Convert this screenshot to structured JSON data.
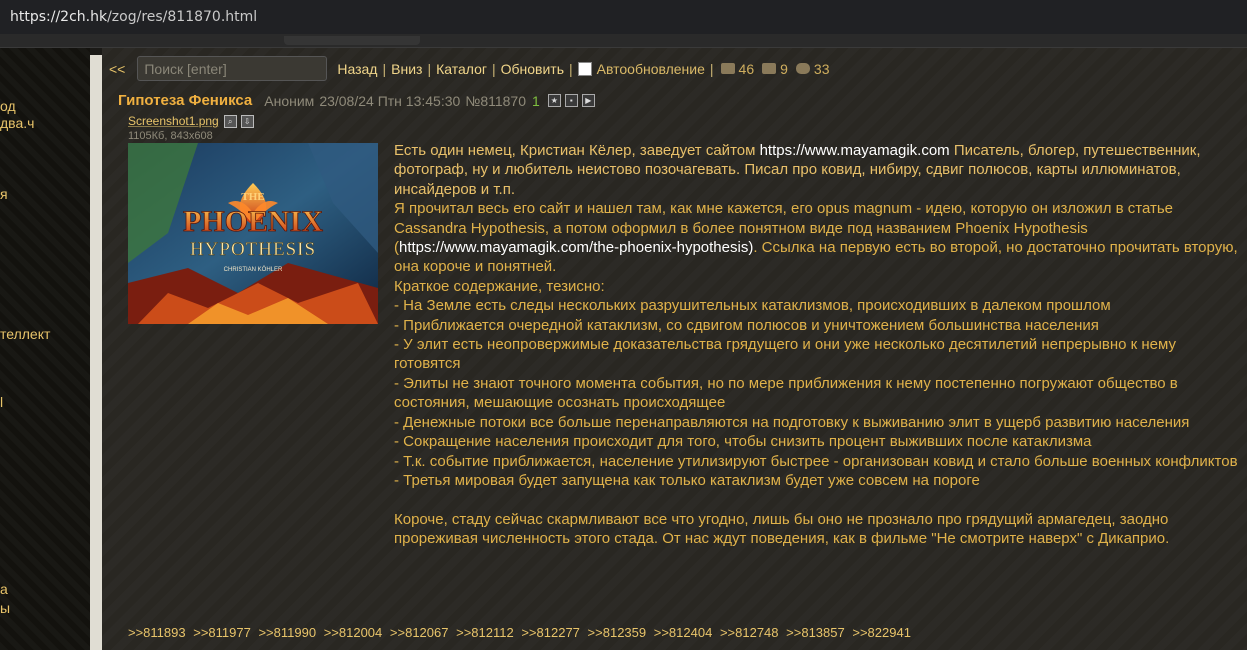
{
  "browser": {
    "url_host": "https://2ch.hk",
    "url_path": "/zog/res/811870.html"
  },
  "sidebar": {
    "items": [
      "од",
      "два.ч",
      "я",
      "теллект",
      "l",
      "а",
      "ы"
    ]
  },
  "toolbar": {
    "back": "<<",
    "search_placeholder": "Поиск [enter]",
    "links": [
      "Назад",
      "Вниз",
      "Каталог",
      "Обновить"
    ],
    "autoupdate_label": "Автообновление",
    "posts_count": "46",
    "images_count": "9",
    "posters_count": "33"
  },
  "post": {
    "title": "Гипотеза Феникса",
    "author": "Аноним",
    "date": "23/08/24 Птн 13:45:30",
    "number": "№811870",
    "ordinal": "1",
    "file": {
      "name": "Screenshot1.png",
      "meta": "1105Кб, 843x608",
      "image_title_top": "THE",
      "image_title_main": "PHOENIX",
      "image_title_sub": "HYPOTHESIS",
      "image_author": "CHRISTIAN KÖHLER"
    },
    "body": {
      "p1_a": "Есть один немец, Кристиан Кёлер, заведует сайтом ",
      "p1_url": "https://www.mayamagik.com",
      "p1_b": " Писатель, блогер, путешественник, фотограф, ну и любитель неистово позочагевать. Писал про ковид, нибиру, сдвиг полюсов, карты иллюминатов, инсайдеров и т.п.",
      "p2_a": "Я прочитал весь его сайт и нашел там, как мне кажется, его opus magnum - идею, которую он изложил в статье Cassandra Hypothesis, а потом оформил в более понятном виде под названием Phoenix Hypothesis (",
      "p2_url": "https://www.mayamagik.com/the-phoenix-hypothesis)",
      "p2_b": ". Ссылка на первую есть во второй, но достаточно прочитать вторую, она короче и понятней.",
      "summary_label": "Краткое содержание, тезисно:",
      "theses": [
        "- На Земле есть следы нескольких разрушительных катаклизмов, происходивших в далеком прошлом",
        "- Приближается очередной катаклизм, со сдвигом полюсов и уничтожением большинства населения",
        "- У элит есть неопровержимые доказательства грядущего и они уже несколько десятилетий непрерывно к нему готовятся",
        "- Элиты не знают точного момента события, но по мере приближения к нему постепенно погружают общество в состояния, мешающие осознать происходящее",
        "- Денежные потоки все больше перенаправляются на подготовку к выживанию элит в ущерб развитию населения",
        "- Сокращение населения происходит для того, чтобы снизить процент выживших после катаклизма",
        "- Т.к. событие приближается, население утилизируют быстрее - организован ковид и стало больше военных конфликтов",
        "- Третья мировая будет запущена как только катаклизм будет уже совсем на пороге"
      ],
      "conclusion": "Короче, стаду сейчас скармливают все что угодно, лишь бы оно не прознало про грядущий армагедец, заодно прореживая численность этого стада. От нас ждут поведения, как в фильме \"Не смотрите наверх\" с Дикаприо."
    },
    "replies": [
      ">>811893",
      ">>811977",
      ">>811990",
      ">>812004",
      ">>812067",
      ">>812112",
      ">>812277",
      ">>812359",
      ">>812404",
      ">>812748",
      ">>813857",
      ">>822941"
    ]
  }
}
